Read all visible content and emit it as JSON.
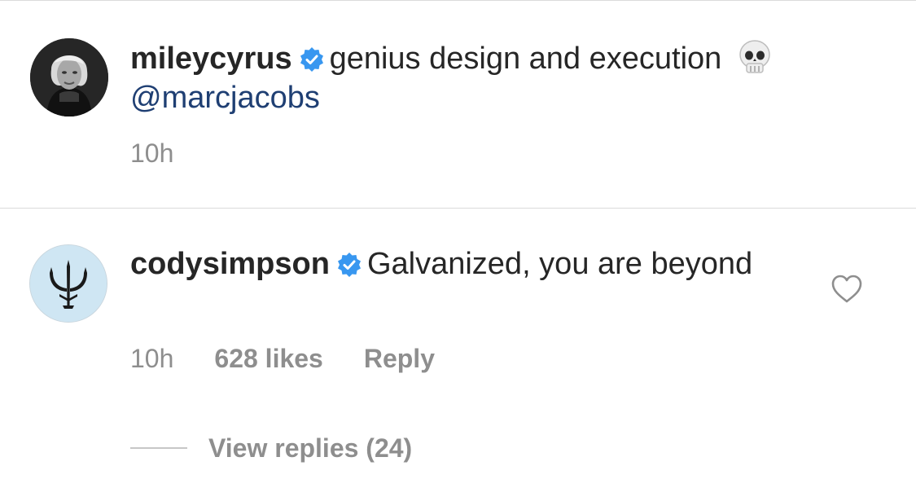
{
  "comments": [
    {
      "username": "mileycyrus",
      "text": "genius design and execution",
      "mention": "@marcjacobs",
      "time": "10h"
    },
    {
      "username": "codysimpson",
      "text": "Galvanized, you are beyond",
      "time": "10h",
      "likes": "628 likes",
      "reply": "Reply",
      "view_replies": "View replies (24)"
    }
  ],
  "icons": {
    "verified": "verified-badge-icon",
    "skull": "skull-emoji-icon",
    "heart": "heart-outline-icon"
  },
  "colors": {
    "verified": "#3897f0",
    "mention": "#1f3f73",
    "muted": "#8e8e8e"
  }
}
